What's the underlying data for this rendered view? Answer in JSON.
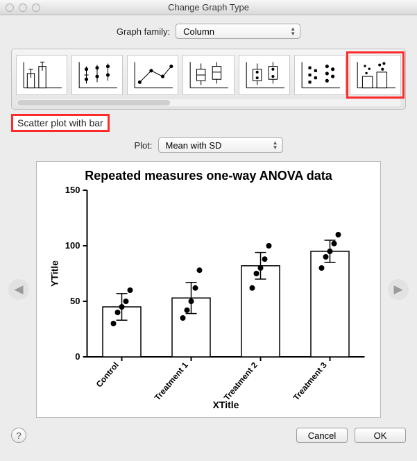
{
  "window": {
    "title": "Change Graph Type"
  },
  "graph_family": {
    "label": "Graph family:",
    "value": "Column"
  },
  "type_options": [
    {
      "name": "Bar"
    },
    {
      "name": "Scatter"
    },
    {
      "name": "Line and scatter"
    },
    {
      "name": "Box and whiskers"
    },
    {
      "name": "Box with scatter"
    },
    {
      "name": "Aligned scatter"
    },
    {
      "name": "Scatter plot with bar",
      "selected": true
    }
  ],
  "selected_type_label": "Scatter plot with bar",
  "plot_select": {
    "label": "Plot:",
    "value": "Mean with SD"
  },
  "chart_data": {
    "type": "bar",
    "title": "Repeated measures one-way ANOVA data",
    "xlabel": "XTitle",
    "ylabel": "YTitle",
    "ylim": [
      0,
      150
    ],
    "yticks": [
      0,
      50,
      100,
      150
    ],
    "categories": [
      "Control",
      "Treatment 1",
      "Treatment 2",
      "Treatment 3"
    ],
    "series": [
      {
        "name": "Mean",
        "values": [
          45,
          53,
          82,
          95
        ]
      }
    ],
    "errors": [
      12,
      14,
      12,
      10
    ],
    "scatter": [
      [
        30,
        40,
        45,
        50,
        60
      ],
      [
        35,
        42,
        50,
        62,
        78
      ],
      [
        62,
        75,
        80,
        88,
        100
      ],
      [
        80,
        90,
        95,
        102,
        110
      ]
    ]
  },
  "footer": {
    "cancel": "Cancel",
    "ok": "OK"
  }
}
